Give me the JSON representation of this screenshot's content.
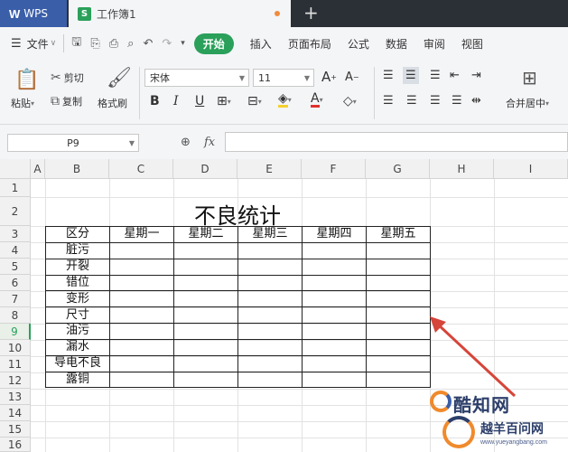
{
  "titlebar": {
    "app_tab": "WPS",
    "doc_tab": "工作簿1",
    "new_tab": "+"
  },
  "menubar": {
    "file": "文件",
    "tabs": [
      "开始",
      "插入",
      "页面布局",
      "公式",
      "数据",
      "审阅",
      "视图"
    ],
    "active_tab": "开始"
  },
  "ribbon": {
    "paste": "粘贴",
    "cut": "剪切",
    "copy": "复制",
    "format_painter": "格式刷",
    "font_name": "宋体",
    "font_size": "11",
    "merge_center": "合并居中",
    "colors": {
      "accent": "#2aa05a",
      "font_color": "#e0312d",
      "fill_color": "#f5d02e"
    }
  },
  "formula_bar": {
    "name_box": "P9",
    "fx": "fx",
    "formula": ""
  },
  "sheet": {
    "columns": [
      "A",
      "B",
      "C",
      "D",
      "E",
      "F",
      "G",
      "H",
      "I"
    ],
    "rows": [
      "1",
      "2",
      "3",
      "4",
      "5",
      "6",
      "7",
      "8",
      "9",
      "10",
      "11",
      "12",
      "13",
      "14",
      "15",
      "16"
    ],
    "active_row": "9",
    "title": "不良统计",
    "table": {
      "header": [
        "区分",
        "星期一",
        "星期二",
        "星期三",
        "星期四",
        "星期五"
      ],
      "categories": [
        "脏污",
        "开裂",
        "错位",
        "变形",
        "尺寸",
        "油污",
        "漏水",
        "导电不良",
        "露铜"
      ]
    }
  },
  "watermark": {
    "brand": "酷知网",
    "brand2": "越羊百问网",
    "url": "www.yueyangbang.com"
  }
}
